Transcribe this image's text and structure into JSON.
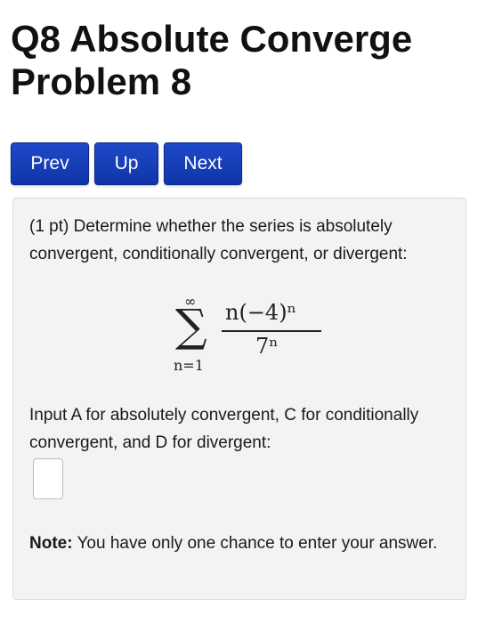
{
  "title": {
    "line1": "Q8 Absolute Converge",
    "line2": "Problem 8"
  },
  "nav": {
    "prev": "Prev",
    "up": "Up",
    "next": "Next"
  },
  "problem": {
    "intro": "(1 pt) Determine whether the series is absolutely convergent, conditionally convergent, or divergent:",
    "series": {
      "upper": "∞",
      "lower": "n=1",
      "numerator": "n(−4)ⁿ",
      "denominator": "7ⁿ"
    },
    "instruction": "Input A for absolutely convergent, C for conditionally convergent, and D for divergent:",
    "answer_value": "",
    "note_label": "Note:",
    "note_text": " You have only one chance to enter your answer."
  }
}
